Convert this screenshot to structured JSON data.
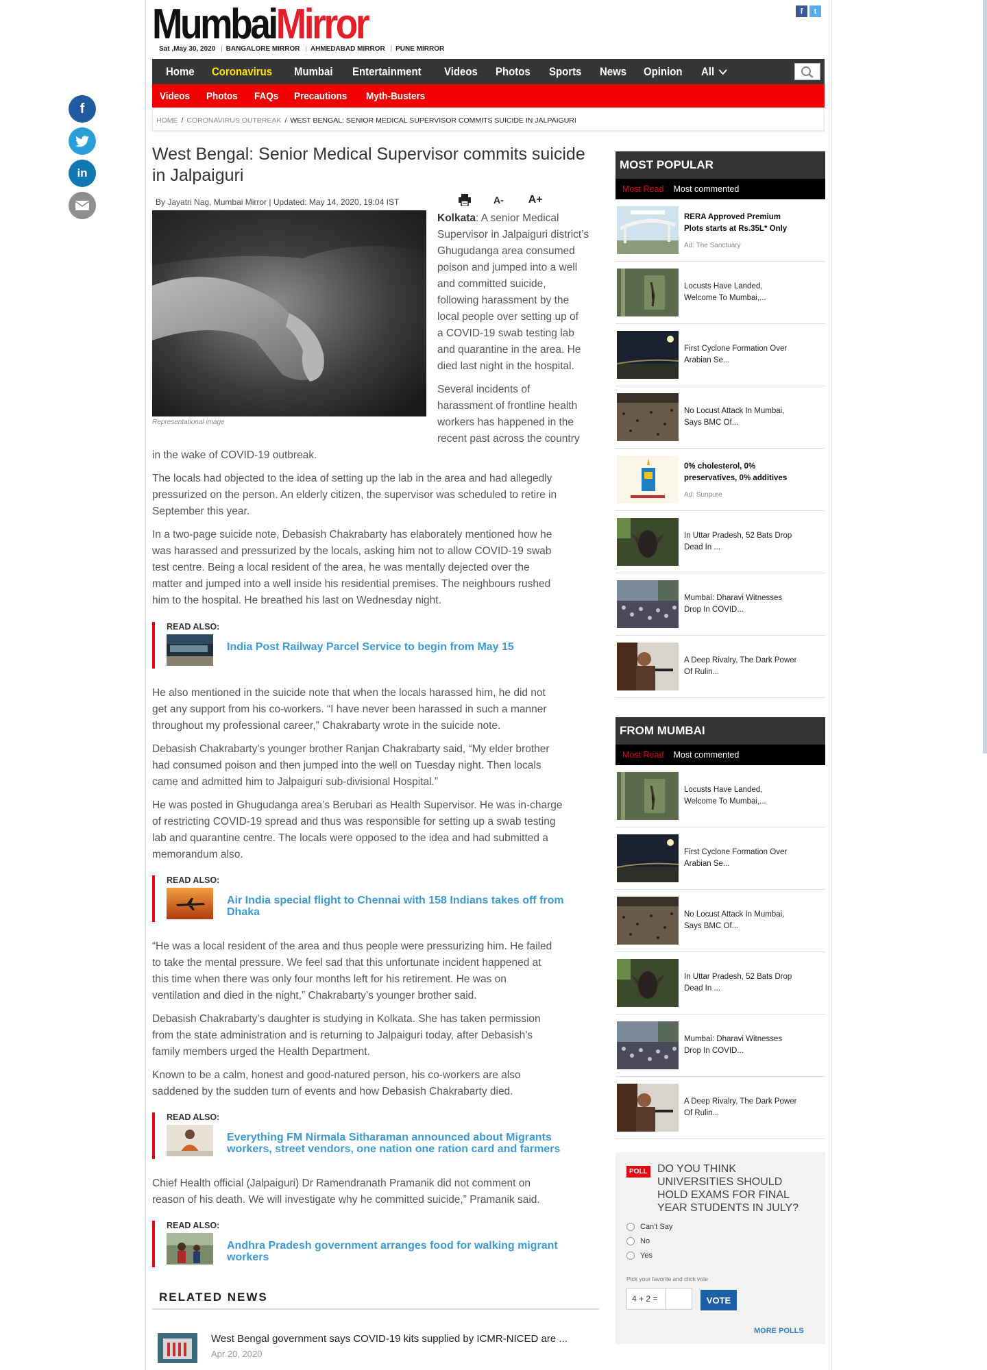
{
  "header": {
    "logo_part1": "Mumbai",
    "logo_part2": "Mirror",
    "date": "Sat ,May 30, 2020",
    "editions": [
      "BANGALORE MIRROR",
      "AHMEDABAD MIRROR",
      "PUNE MIRROR"
    ]
  },
  "nav": {
    "items": [
      "Home",
      "Coronavirus",
      "Mumbai",
      "Entertainment",
      "Videos",
      "Photos",
      "Sports",
      "News",
      "Opinion",
      "All"
    ],
    "highlight_color": "#ffe600"
  },
  "subnav": {
    "items": [
      "Videos",
      "Photos",
      "FAQs",
      "Precautions",
      "Myth-Busters"
    ]
  },
  "breadcrumb": {
    "home": "HOME",
    "section": "CORONAVIRUS OUTBREAK",
    "current": "WEST BENGAL: SENIOR MEDICAL SUPERVISOR COMMITS SUICIDE IN JALPAIGURI"
  },
  "article": {
    "title": "West Bengal: Senior Medical Supervisor commits suicide in Jalpaiguri",
    "by": "By",
    "author": "Jayatri Nag",
    "publication": "Mumbai Mirror",
    "updated": "Updated: May 14, 2020, 19:04 IST",
    "font_small": "A-",
    "font_large": "A+",
    "caption": "Representational image",
    "p1_lead": "Kolkata",
    "p1_l1": ": A senior Medical",
    "p1_l2": "Supervisor in Jalpaiguri district’s",
    "p1_l3": "Ghugudanga area consumed",
    "p1_l4": "poison and jumped into a well",
    "p1_l5": "and committed suicide,",
    "p1_l6": "following harassment by the",
    "p1_l7": "local people over setting up of",
    "p1_l8": "a COVID-19 swab testing lab",
    "p1_l9": "and quarantine in the area. He",
    "p1_l10": "died last night in the hospital.",
    "p2_l1": "Several incidents of",
    "p2_l2": "harassment of frontline health",
    "p2_l3": "workers has happened in the",
    "p2_l4": "recent past across the country",
    "p2_l5": "in the wake of COVID-19 outbreak.",
    "p3_l1": "The locals had objected to the idea of setting up the lab in the area and had allegedly",
    "p3_l2": "pressurized on the person. An elderly citizen, the supervisor was scheduled to retire in",
    "p3_l3": "September this year.",
    "p4_l1": "In a two-page suicide note, Debasish Chakrabarty has elaborately mentioned how he",
    "p4_l2": "was harassed and pressurized by the locals, asking him not to allow COVID-19 swab",
    "p4_l3": "test centre. Being a local resident of the area, he was mentally dejected over the",
    "p4_l4": "matter and jumped into a well inside his residential premises. The neighbours rushed",
    "p4_l5": "him to the hospital. He breathed his last on Wednesday night.",
    "p5_l1": "He also mentioned in the suicide note that when the locals harassed him, he did not",
    "p5_l2": "get any support from his co-workers. “I have never been harassed in such a manner",
    "p5_l3": "throughout my professional career,” Chakrabarty wrote in the suicide note.",
    "p6_l1": "Debasish Chakrabarty’s younger brother Ranjan Chakrabarty said, “My elder brother",
    "p6_l2": "had consumed poison and then jumped into the well on Tuesday night. Then locals",
    "p6_l3": "came and admitted him to Jalpaiguri sub-divisional Hospital.”",
    "p7_l1": "He was posted in Ghugudanga area’s Berubari as Health Supervisor. He was in-charge",
    "p7_l2": "of restricting COVID-19 spread and thus was responsible for setting up a swab testing",
    "p7_l3": "lab and quarantine centre. The locals were opposed to the idea and had submitted a",
    "p7_l4": "memorandum also.",
    "p8_l1": "“He was a local resident of the area and thus people were pressurizing him. He failed",
    "p8_l2": "to take the mental pressure. We feel sad that this unfortunate incident happened at",
    "p8_l3": "this time when there was only four months left for his retirement. He was on",
    "p8_l4": "ventilation and died in the night,” Chakrabarty’s younger brother said.",
    "p9_l1": "Debasish Chakrabarty’s daughter is studying in Kolkata. She has taken permission",
    "p9_l2": "from the state administration and is returning to Jalpaiguri today, after Debasish’s",
    "p9_l3": "family members urged the Health Department.",
    "p10_l1": "Known to be a calm, honest and good-natured person, his co-workers are also",
    "p10_l2": "saddened by the sudden turn of events and how Debasish Chakrabarty died.",
    "p11_l1": "Chief Health official (Jalpaiguri) Dr Ramendranath Pramanik did not comment on",
    "p11_l2": "reason of his death. We will investigate why he committed suicide,” Pramanik said."
  },
  "read_also": [
    {
      "label": "READ ALSO:",
      "l1": "India Post Railway Parcel Service to begin from May 15",
      "l2": ""
    },
    {
      "label": "READ ALSO:",
      "l1": "Air India special flight to Chennai with 158 Indians takes off from",
      "l2": "Dhaka"
    },
    {
      "label": "READ ALSO:",
      "l1": "Everything FM Nirmala Sitharaman announced about Migrants",
      "l2": "workers, street vendors, one nation one ration card and farmers"
    },
    {
      "label": "READ ALSO:",
      "l1": "Andhra Pradesh government arranges food for walking migrant",
      "l2": "workers"
    }
  ],
  "related": {
    "heading": "RELATED NEWS",
    "item_title": "West Bengal government says COVID-19 kits supplied by ICMR-NICED are ...",
    "item_date": "Apr 20, 2020"
  },
  "sidebar": {
    "most_popular": "MOST POPULAR",
    "from_mumbai": "FROM MUMBAI",
    "tab_read": "Most Read",
    "tab_commented": "Most commented",
    "popular": [
      {
        "l1": "RERA Approved Premium",
        "l2": "Plots starts at Rs.35L* Only",
        "ad": "Ad: The Sanctuary"
      },
      {
        "l1": "Locusts Have Landed,",
        "l2": "Welcome To Mumbai,..."
      },
      {
        "l1": "First Cyclone Formation Over",
        "l2": "Arabian Se..."
      },
      {
        "l1": "No Locust Attack In Mumbai,",
        "l2": "Says BMC Of..."
      },
      {
        "l1": "0% cholesterol, 0%",
        "l2": "preservatives, 0% additives",
        "ad": "Ad: Sunpure"
      },
      {
        "l1": "In Uttar Pradesh, 52 Bats Drop",
        "l2": "Dead In ..."
      },
      {
        "l1": "Mumbai: Dharavi Witnesses",
        "l2": "Drop In COVID..."
      },
      {
        "l1": "A Deep Rivalry, The Dark Power",
        "l2": "Of Rulin..."
      }
    ],
    "mumbai": [
      {
        "l1": "Locusts Have Landed,",
        "l2": "Welcome To Mumbai,..."
      },
      {
        "l1": "First Cyclone Formation Over",
        "l2": "Arabian Se..."
      },
      {
        "l1": "No Locust Attack In Mumbai,",
        "l2": "Says BMC Of..."
      },
      {
        "l1": "In Uttar Pradesh, 52 Bats Drop",
        "l2": "Dead In ..."
      },
      {
        "l1": "Mumbai: Dharavi Witnesses",
        "l2": "Drop In COVID..."
      },
      {
        "l1": "A Deep Rivalry, The Dark Power",
        "l2": "Of Rulin..."
      }
    ]
  },
  "poll": {
    "badge": "POLL",
    "question": "DO YOU THINK UNIVERSITIES SHOULD HOLD EXAMS FOR FINAL YEAR STUDENTS IN JULY?",
    "options": [
      "Can't Say",
      "No",
      "Yes"
    ],
    "hint": "Pick your favorite and click vote",
    "captcha": "4 + 2 =",
    "vote": "VOTE",
    "more": "MORE POLLS"
  }
}
